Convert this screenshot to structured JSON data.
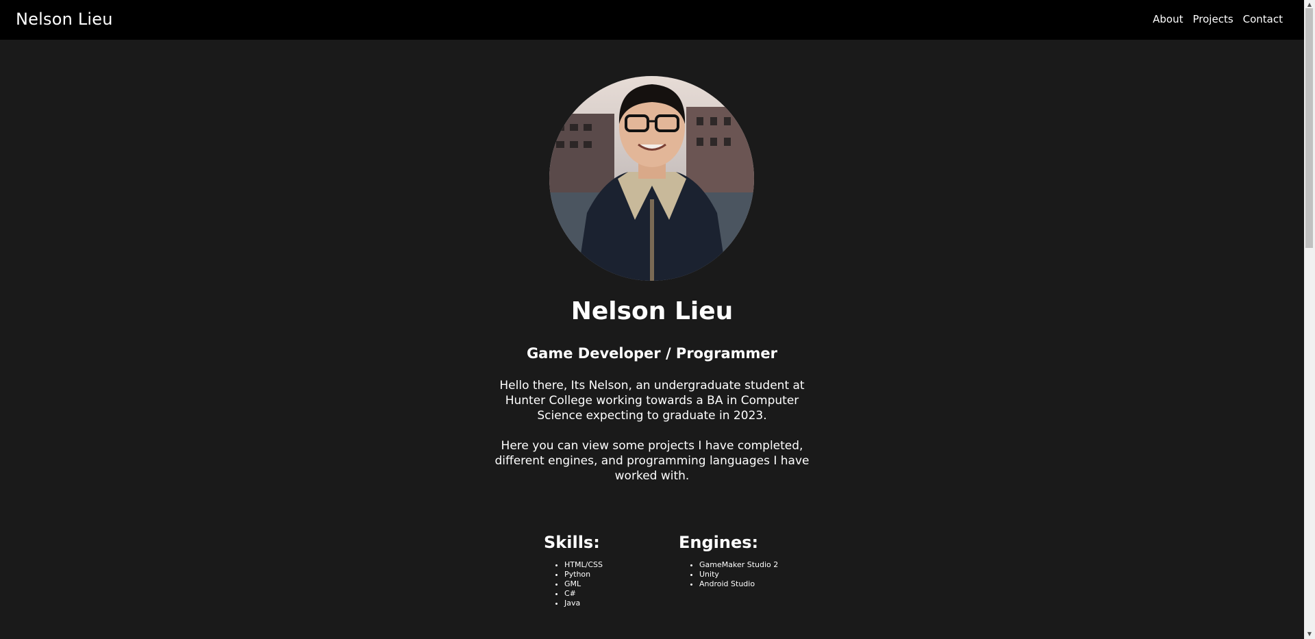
{
  "navbar": {
    "brand": "Nelson Lieu",
    "links": [
      "About",
      "Projects",
      "Contact"
    ]
  },
  "profile": {
    "avatar_icon": "profile-photo",
    "name": "Nelson Lieu",
    "role": "Game Developer / Programmer",
    "bio": [
      "Hello there, Its Nelson, an undergraduate student at Hunter College working towards a BA in Computer Science expecting to graduate in 2023.",
      "Here you can view some projects I have completed, different engines, and programming languages I have worked with."
    ]
  },
  "skills": {
    "heading": "Skills:",
    "items": [
      "HTML/CSS",
      "Python",
      "GML",
      "C#",
      "Java"
    ]
  },
  "engines": {
    "heading": "Engines:",
    "items": [
      "GameMaker Studio 2",
      "Unity",
      "Android Studio"
    ]
  },
  "colors": {
    "navbar_bg": "#000000",
    "page_bg": "#1a1a1a",
    "text": "#ffffff"
  }
}
